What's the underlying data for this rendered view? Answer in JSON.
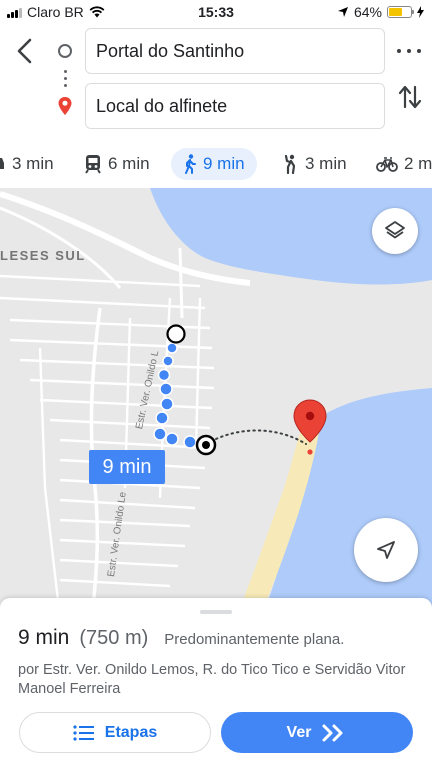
{
  "status_bar": {
    "carrier": "Claro BR",
    "time": "15:33",
    "battery": "64%",
    "battery_level": 0.64
  },
  "route": {
    "origin": "Portal do Santinho",
    "destination": "Local do alfinete"
  },
  "modes": [
    {
      "name": "car",
      "time": "3 min"
    },
    {
      "name": "transit",
      "time": "6 min"
    },
    {
      "name": "walk",
      "time": "9 min",
      "active": true
    },
    {
      "name": "ride",
      "time": "3 min"
    },
    {
      "name": "bike",
      "time": "2 m"
    }
  ],
  "map": {
    "area_label": "LESES SUL",
    "street_label_1": "Estr. Ver. Onildo L",
    "street_label_2": "Estr. Ver. Onildo Le",
    "time_badge": "9 min",
    "colors": {
      "water": "#aecbfa",
      "land": "#e8e8e8",
      "sand": "#f7eab8",
      "route": "#4285f4",
      "pin": "#ea4335"
    }
  },
  "sheet": {
    "duration": "9 min",
    "distance": "(750 m)",
    "terrain": "Predominantemente plana.",
    "via": "por Estr. Ver. Onildo Lemos, R. do Tico Tico e Servidão Vitor Manoel Ferreira",
    "steps_button": "Etapas",
    "view_button": "Ver"
  }
}
